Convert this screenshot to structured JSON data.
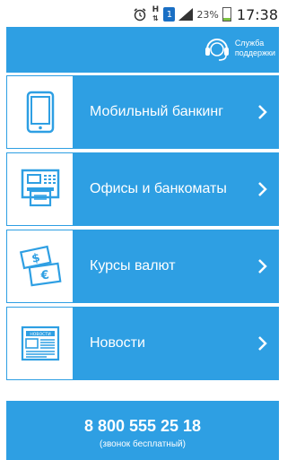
{
  "status_bar": {
    "network": "H",
    "sim_label": "1",
    "battery_percent": "23%",
    "battery_level": 0.23,
    "time": "17:38"
  },
  "header": {
    "support_label_line1": "Служба",
    "support_label_line2": "поддержки"
  },
  "menu": {
    "items": [
      {
        "label": "Мобильный банкинг",
        "icon": "tablet-icon"
      },
      {
        "label": "Офисы и банкоматы",
        "icon": "atm-icon"
      },
      {
        "label": "Курсы валют",
        "icon": "currency-icon"
      },
      {
        "label": "Новости",
        "icon": "newspaper-icon"
      }
    ]
  },
  "footer": {
    "phone": "8 800 555 25 18",
    "note": "(звонок бесплатный)"
  },
  "colors": {
    "accent": "#2e9fe3",
    "background": "#ffffff"
  },
  "icons": {
    "newspaper_heading": "НОВОСТИ"
  }
}
